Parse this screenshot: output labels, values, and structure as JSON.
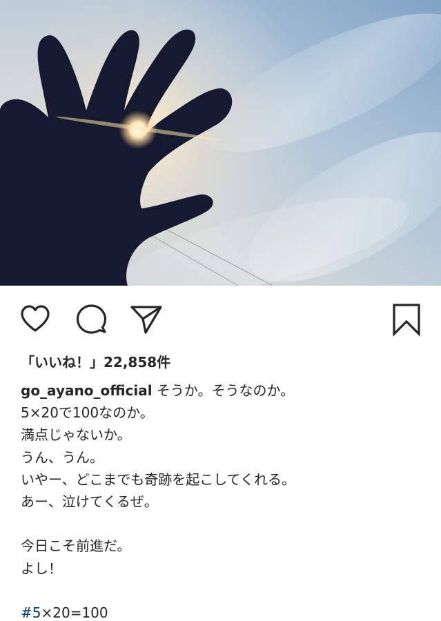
{
  "post": {
    "image": {
      "subject": "hand silhouette against sunlit sky",
      "colors": {
        "sky_top": "#a4bfd9",
        "sky_mid": "#c9d6de",
        "sun_glow": "#f3e4cb",
        "silhouette": "#161a30"
      }
    },
    "actions": {
      "like_icon": "heart-outline-icon",
      "comment_icon": "speech-bubble-icon",
      "share_icon": "paper-plane-icon",
      "save_icon": "bookmark-outline-icon"
    },
    "likes_text": "「いいね！」22,858件",
    "caption": {
      "username": "go_ayano_official",
      "first_line": " そうか。そうなのか。",
      "lines": [
        "5×20で100なのか。",
        "満点じゃないか。",
        "うん、うん。",
        "いやー、どこまでも奇跡を起こしてくれる。",
        "あー、泣けてくるぜ。",
        "",
        "今日こそ前進だ。",
        "よし！",
        ""
      ],
      "hashtag": "#5",
      "hashtag_rest": "×20=100"
    },
    "colors": {
      "text": "#262626",
      "hashtag": "#003569",
      "background": "#ffffff"
    }
  }
}
